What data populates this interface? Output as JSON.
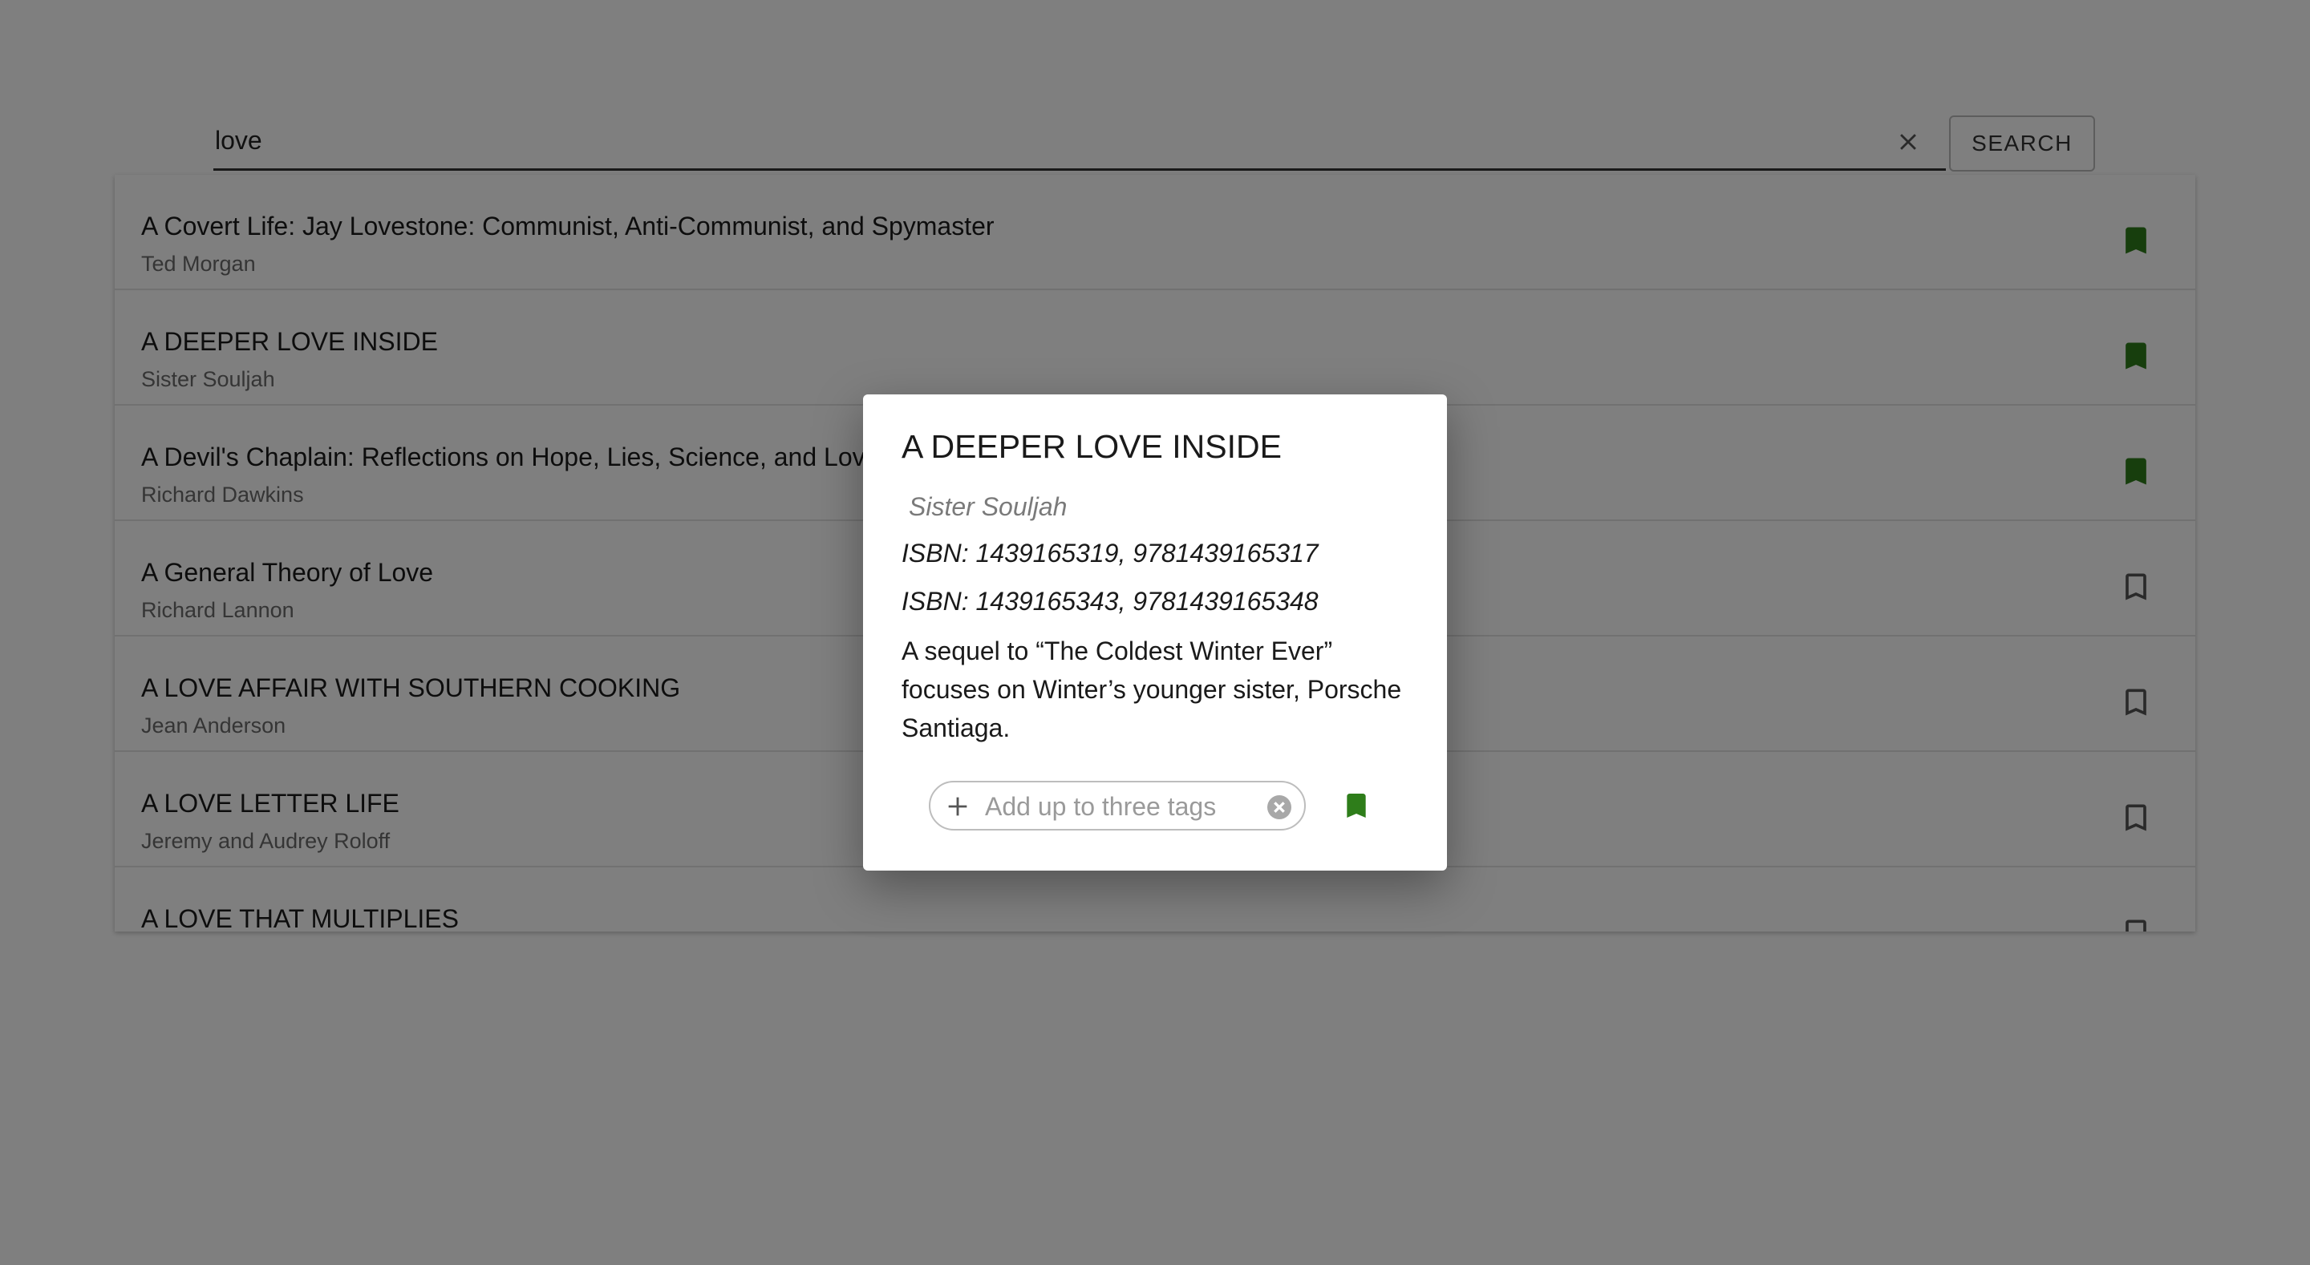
{
  "search": {
    "value": "love",
    "placeholder": "",
    "button_label": "SEARCH"
  },
  "results": [
    {
      "title": "A Covert Life: Jay Lovestone: Communist, Anti-Communist, and Spymaster",
      "author": "Ted Morgan",
      "bookmarked": true
    },
    {
      "title": "A DEEPER LOVE INSIDE",
      "author": "Sister Souljah",
      "bookmarked": true
    },
    {
      "title": "A Devil's Chaplain: Reflections on Hope, Lies, Science, and Love",
      "author": "Richard Dawkins",
      "bookmarked": true
    },
    {
      "title": "A General Theory of Love",
      "author": "Richard Lannon",
      "bookmarked": false
    },
    {
      "title": "A LOVE AFFAIR WITH SOUTHERN COOKING",
      "author": "Jean Anderson",
      "bookmarked": false
    },
    {
      "title": "A LOVE LETTER LIFE",
      "author": "Jeremy and Audrey Roloff",
      "bookmarked": false
    },
    {
      "title": "A LOVE THAT MULTIPLIES",
      "author": "",
      "bookmarked": false
    }
  ],
  "dialog": {
    "title": "A DEEPER LOVE INSIDE",
    "author": "Sister Souljah",
    "isbn_1": "ISBN: 1439165319, 9781439165317",
    "isbn_2": "ISBN: 1439165343, 9781439165348",
    "description": "A sequel to “The Coldest Winter Ever” focuses on Winter’s younger sister, Porsche Santiaga.",
    "tag_placeholder": "Add up to three tags",
    "bookmarked": true
  },
  "icons": {
    "clear": "close-icon",
    "bookmark_filled": "bookmark-filled-icon",
    "bookmark_outline": "bookmark-outline-icon",
    "add": "plus-icon",
    "cancel": "cancel-circle-icon"
  },
  "colors": {
    "bookmark_active": "#2e7d1a",
    "bookmark_inactive": "#555555"
  }
}
